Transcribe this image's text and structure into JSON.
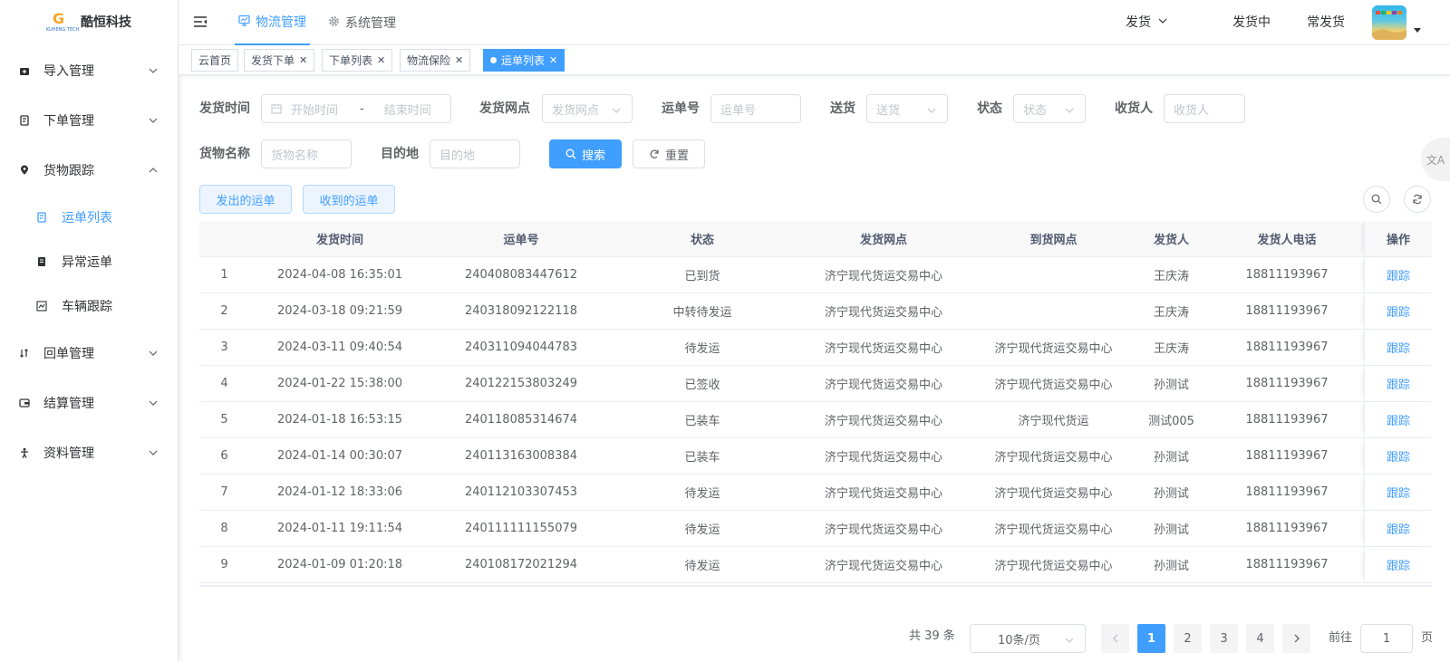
{
  "app": {
    "company_name": "酷恒科技",
    "logo_caption": "KUHENG TECH",
    "accent_color": "#409eff"
  },
  "sidebar": {
    "items": [
      {
        "label": "导入管理",
        "icon": "import-icon",
        "expanded": false
      },
      {
        "label": "下单管理",
        "icon": "order-icon",
        "expanded": false
      },
      {
        "label": "货物跟踪",
        "icon": "location-pin-icon",
        "expanded": true,
        "children": [
          {
            "label": "运单列表",
            "icon": "document-icon",
            "active": true
          },
          {
            "label": "异常运单",
            "icon": "book-icon",
            "active": false
          },
          {
            "label": "车辆跟踪",
            "icon": "vehicle-track-icon",
            "active": false
          }
        ]
      },
      {
        "label": "回单管理",
        "icon": "receipt-return-icon",
        "expanded": false
      },
      {
        "label": "结算管理",
        "icon": "settlement-icon",
        "expanded": false
      },
      {
        "label": "资料管理",
        "icon": "profile-icon",
        "expanded": false
      }
    ]
  },
  "header": {
    "tabs": [
      {
        "label": "物流管理",
        "icon": "monitor-icon",
        "active": true
      },
      {
        "label": "系统管理",
        "icon": "gear-icon",
        "active": false
      }
    ],
    "links": [
      {
        "label": "发货",
        "has_dropdown": true
      },
      {
        "label": "发货中",
        "has_dropdown": false
      },
      {
        "label": "常发货",
        "has_dropdown": false
      }
    ]
  },
  "tags": [
    {
      "label": "云首页",
      "closable": false,
      "active": false
    },
    {
      "label": "发货下单",
      "closable": true,
      "active": false
    },
    {
      "label": "下单列表",
      "closable": true,
      "active": false
    },
    {
      "label": "物流保险",
      "closable": true,
      "active": false
    },
    {
      "label": "运单列表",
      "closable": true,
      "active": true
    }
  ],
  "filters": {
    "ship_time": {
      "label": "发货时间",
      "start_placeholder": "开始时间",
      "separator": "-",
      "end_placeholder": "结束时间"
    },
    "ship_point": {
      "label": "发货网点",
      "placeholder": "发货网点"
    },
    "waybill_no": {
      "label": "运单号",
      "placeholder": "运单号"
    },
    "delivery": {
      "label": "送货",
      "placeholder": "送货"
    },
    "status": {
      "label": "状态",
      "placeholder": "状态"
    },
    "receiver": {
      "label": "收货人",
      "placeholder": "收货人"
    },
    "goods_name": {
      "label": "货物名称",
      "placeholder": "货物名称"
    },
    "destination": {
      "label": "目的地",
      "placeholder": "目的地"
    },
    "search_label": "搜索",
    "reset_label": "重置"
  },
  "toggles": {
    "sent_label": "发出的运单",
    "received_label": "收到的运单"
  },
  "table": {
    "columns": [
      "",
      "发货时间",
      "运单号",
      "状态",
      "发货网点",
      "到货网点",
      "发货人",
      "发货人电话",
      "操作"
    ],
    "rows": [
      {
        "idx": "1",
        "time": "2024-04-08 16:35:01",
        "no": "240408083447612",
        "status": "已到货",
        "from": "济宁现代货运交易中心",
        "to": "",
        "sender": "王庆涛",
        "phone": "18811193967",
        "op": "跟踪"
      },
      {
        "idx": "2",
        "time": "2024-03-18 09:21:59",
        "no": "240318092122118",
        "status": "中转待发运",
        "from": "济宁现代货运交易中心",
        "to": "",
        "sender": "王庆涛",
        "phone": "18811193967",
        "op": "跟踪"
      },
      {
        "idx": "3",
        "time": "2024-03-11 09:40:54",
        "no": "240311094044783",
        "status": "待发运",
        "from": "济宁现代货运交易中心",
        "to": "济宁现代货运交易中心",
        "sender": "王庆涛",
        "phone": "18811193967",
        "op": "跟踪"
      },
      {
        "idx": "4",
        "time": "2024-01-22 15:38:00",
        "no": "240122153803249",
        "status": "已签收",
        "from": "济宁现代货运交易中心",
        "to": "济宁现代货运交易中心",
        "sender": "孙测试",
        "phone": "18811193967",
        "op": "跟踪"
      },
      {
        "idx": "5",
        "time": "2024-01-18 16:53:15",
        "no": "240118085314674",
        "status": "已装车",
        "from": "济宁现代货运交易中心",
        "to": "济宁现代货运",
        "sender": "测试005",
        "phone": "18811193967",
        "op": "跟踪"
      },
      {
        "idx": "6",
        "time": "2024-01-14 00:30:07",
        "no": "240113163008384",
        "status": "已装车",
        "from": "济宁现代货运交易中心",
        "to": "济宁现代货运交易中心",
        "sender": "孙测试",
        "phone": "18811193967",
        "op": "跟踪"
      },
      {
        "idx": "7",
        "time": "2024-01-12 18:33:06",
        "no": "240112103307453",
        "status": "待发运",
        "from": "济宁现代货运交易中心",
        "to": "济宁现代货运交易中心",
        "sender": "孙测试",
        "phone": "18811193967",
        "op": "跟踪"
      },
      {
        "idx": "8",
        "time": "2024-01-11 19:11:54",
        "no": "240111111155079",
        "status": "待发运",
        "from": "济宁现代货运交易中心",
        "to": "济宁现代货运交易中心",
        "sender": "孙测试",
        "phone": "18811193967",
        "op": "跟踪"
      },
      {
        "idx": "9",
        "time": "2024-01-09 01:20:18",
        "no": "240108172021294",
        "status": "待发运",
        "from": "济宁现代货运交易中心",
        "to": "济宁现代货运交易中心",
        "sender": "孙测试",
        "phone": "18811193967",
        "op": "跟踪"
      }
    ]
  },
  "pagination": {
    "total_text": "共 39 条",
    "page_size": "10条/页",
    "pages": [
      "1",
      "2",
      "3",
      "4"
    ],
    "current_page": "1",
    "goto_prefix": "前往",
    "goto_value": "1",
    "goto_suffix": "页"
  }
}
